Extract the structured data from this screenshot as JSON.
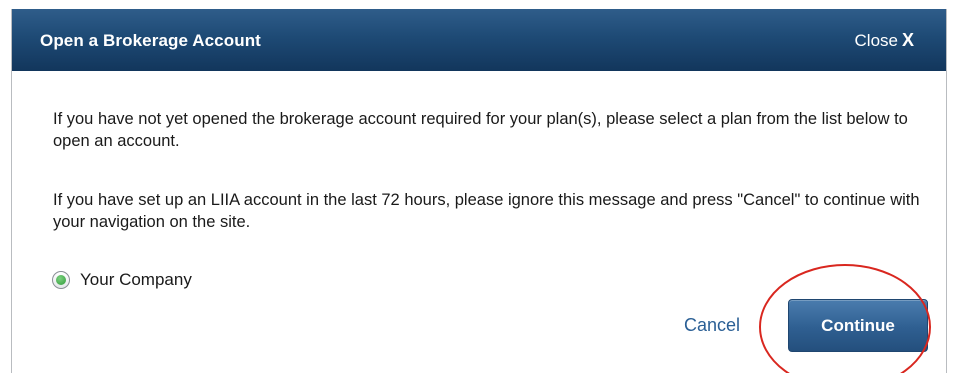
{
  "dialog": {
    "title": "Open a Brokerage Account",
    "close_label": "Close",
    "close_glyph": "X",
    "paragraph_1": "If you have not yet opened the brokerage account required for your plan(s), please select a plan from the list below to open an account.",
    "paragraph_2": "If you have set up an LIIA account in the last 72 hours, please ignore this message and press \"Cancel\" to continue with your navigation on the site.",
    "plan_option": {
      "label": "Your Company",
      "selected": true
    },
    "cancel_label": "Cancel",
    "continue_label": "Continue"
  },
  "colors": {
    "header_bg": "#1e4a75",
    "link": "#2a5f95",
    "button_bg": "#2f5f91",
    "highlight_ring": "#d9271f",
    "radio_selected": "#2f9a3a"
  }
}
